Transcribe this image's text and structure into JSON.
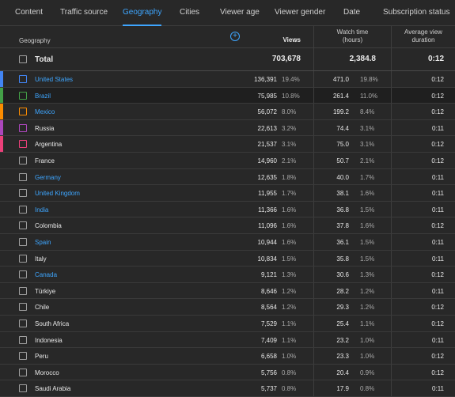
{
  "tabs": [
    {
      "label": "Content",
      "active": false
    },
    {
      "label": "Traffic source",
      "active": false
    },
    {
      "label": "Geography",
      "active": true
    },
    {
      "label": "Cities",
      "active": false
    },
    {
      "label": "Viewer age",
      "active": false
    },
    {
      "label": "Viewer gender",
      "active": false
    },
    {
      "label": "Date",
      "active": false
    },
    {
      "label": "Subscription status",
      "active": false
    }
  ],
  "columns": {
    "geography": "Geography",
    "add_icon": "+",
    "views": "Views",
    "sort_arrow": "↓",
    "watch_time_line1": "Watch time",
    "watch_time_line2": "(hours)",
    "avd_line1": "Average view",
    "avd_line2": "duration"
  },
  "total": {
    "label": "Total",
    "views": "703,678",
    "watch_time": "2,384.8",
    "avd": "0:12"
  },
  "rows": [
    {
      "country": "United States",
      "link": true,
      "views": "136,391",
      "views_pct": "19.4%",
      "watch_time": "471.0",
      "wt_pct": "19.8%",
      "avd": "0:12",
      "color": "#4285f4",
      "hl": false
    },
    {
      "country": "Brazil",
      "link": true,
      "views": "75,985",
      "views_pct": "10.8%",
      "watch_time": "261.4",
      "wt_pct": "11.0%",
      "avd": "0:12",
      "color": "#43a047",
      "hl": true
    },
    {
      "country": "Mexico",
      "link": true,
      "views": "56,072",
      "views_pct": "8.0%",
      "watch_time": "199.2",
      "wt_pct": "8.4%",
      "avd": "0:12",
      "color": "#fb8c00",
      "hl": false
    },
    {
      "country": "Russia",
      "link": false,
      "views": "22,613",
      "views_pct": "3.2%",
      "watch_time": "74.4",
      "wt_pct": "3.1%",
      "avd": "0:11",
      "color": "#ab47bc",
      "hl": false
    },
    {
      "country": "Argentina",
      "link": false,
      "views": "21,537",
      "views_pct": "3.1%",
      "watch_time": "75.0",
      "wt_pct": "3.1%",
      "avd": "0:12",
      "color": "#ec407a",
      "hl": false
    },
    {
      "country": "France",
      "link": false,
      "views": "14,960",
      "views_pct": "2.1%",
      "watch_time": "50.7",
      "wt_pct": "2.1%",
      "avd": "0:12",
      "color": "",
      "hl": false
    },
    {
      "country": "Germany",
      "link": true,
      "views": "12,635",
      "views_pct": "1.8%",
      "watch_time": "40.0",
      "wt_pct": "1.7%",
      "avd": "0:11",
      "color": "",
      "hl": false
    },
    {
      "country": "United Kingdom",
      "link": true,
      "views": "11,955",
      "views_pct": "1.7%",
      "watch_time": "38.1",
      "wt_pct": "1.6%",
      "avd": "0:11",
      "color": "",
      "hl": false
    },
    {
      "country": "India",
      "link": true,
      "views": "11,366",
      "views_pct": "1.6%",
      "watch_time": "36.8",
      "wt_pct": "1.5%",
      "avd": "0:11",
      "color": "",
      "hl": false
    },
    {
      "country": "Colombia",
      "link": false,
      "views": "11,096",
      "views_pct": "1.6%",
      "watch_time": "37.8",
      "wt_pct": "1.6%",
      "avd": "0:12",
      "color": "",
      "hl": false
    },
    {
      "country": "Spain",
      "link": true,
      "views": "10,944",
      "views_pct": "1.6%",
      "watch_time": "36.1",
      "wt_pct": "1.5%",
      "avd": "0:11",
      "color": "",
      "hl": false
    },
    {
      "country": "Italy",
      "link": false,
      "views": "10,834",
      "views_pct": "1.5%",
      "watch_time": "35.8",
      "wt_pct": "1.5%",
      "avd": "0:11",
      "color": "",
      "hl": false
    },
    {
      "country": "Canada",
      "link": true,
      "views": "9,121",
      "views_pct": "1.3%",
      "watch_time": "30.6",
      "wt_pct": "1.3%",
      "avd": "0:12",
      "color": "",
      "hl": false
    },
    {
      "country": "Türkiye",
      "link": false,
      "views": "8,646",
      "views_pct": "1.2%",
      "watch_time": "28.2",
      "wt_pct": "1.2%",
      "avd": "0:11",
      "color": "",
      "hl": false
    },
    {
      "country": "Chile",
      "link": false,
      "views": "8,564",
      "views_pct": "1.2%",
      "watch_time": "29.3",
      "wt_pct": "1.2%",
      "avd": "0:12",
      "color": "",
      "hl": false
    },
    {
      "country": "South Africa",
      "link": false,
      "views": "7,529",
      "views_pct": "1.1%",
      "watch_time": "25.4",
      "wt_pct": "1.1%",
      "avd": "0:12",
      "color": "",
      "hl": false
    },
    {
      "country": "Indonesia",
      "link": false,
      "views": "7,409",
      "views_pct": "1.1%",
      "watch_time": "23.2",
      "wt_pct": "1.0%",
      "avd": "0:11",
      "color": "",
      "hl": false
    },
    {
      "country": "Peru",
      "link": false,
      "views": "6,658",
      "views_pct": "1.0%",
      "watch_time": "23.3",
      "wt_pct": "1.0%",
      "avd": "0:12",
      "color": "",
      "hl": false
    },
    {
      "country": "Morocco",
      "link": false,
      "views": "5,756",
      "views_pct": "0.8%",
      "watch_time": "20.4",
      "wt_pct": "0.9%",
      "avd": "0:12",
      "color": "",
      "hl": false
    },
    {
      "country": "Saudi Arabia",
      "link": false,
      "views": "5,737",
      "views_pct": "0.8%",
      "watch_time": "17.9",
      "wt_pct": "0.8%",
      "avd": "0:11",
      "color": "",
      "hl": false
    }
  ]
}
